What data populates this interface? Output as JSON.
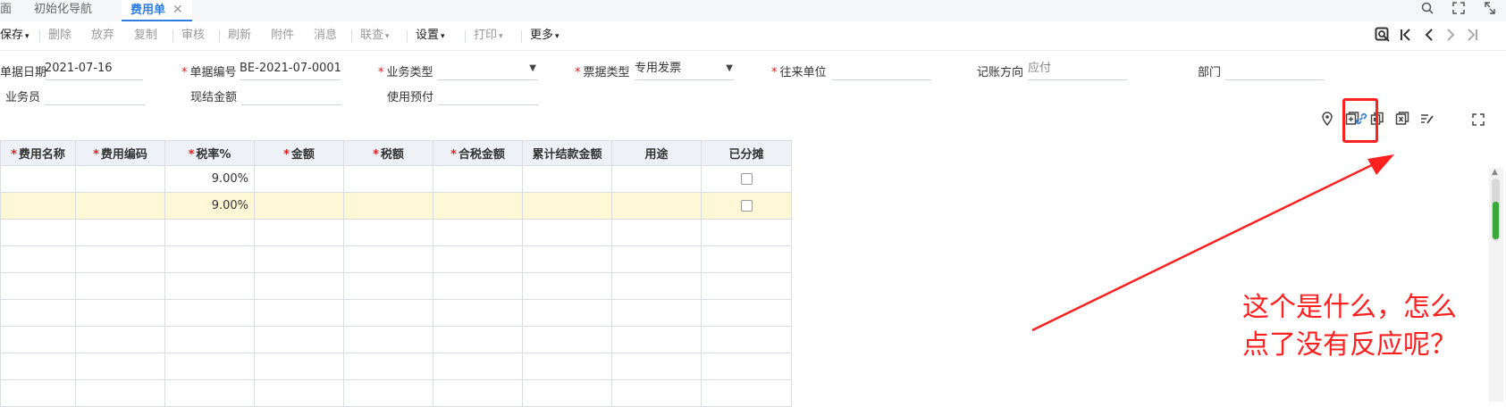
{
  "tabs": [
    {
      "label": "面",
      "active": false
    },
    {
      "label": "初始化导航",
      "active": false
    },
    {
      "label": "费用单",
      "active": true
    }
  ],
  "tab_close_glyph": "✕",
  "window_icons": [
    "search-icon",
    "expand-icon",
    "restore-icon"
  ],
  "toolbar": {
    "save": "保存",
    "delete": "删除",
    "discard": "放弃",
    "copy": "复制",
    "audit": "审核",
    "refresh": "刷新",
    "attachment": "附件",
    "message": "消息",
    "linked_query": "联查",
    "settings": "设置",
    "print": "打印",
    "more": "更多"
  },
  "nav_icons": [
    "search-doc-icon",
    "first-page-icon",
    "prev-page-icon",
    "next-page-icon",
    "last-page-icon"
  ],
  "form": {
    "doc_date_label": "单据日期",
    "doc_date_value": "2021-07-16",
    "doc_no_label": "单据编号",
    "doc_no_value": "BE-2021-07-0001",
    "biz_type_label": "业务类型",
    "biz_type_value": "",
    "invoice_type_label": "票据类型",
    "invoice_type_value": "专用发票",
    "partner_label": "往来单位",
    "partner_value": "",
    "direction_label": "记账方向",
    "direction_value": "应付",
    "dept_label": "部门",
    "dept_value": "",
    "clerk_label": "业务员",
    "clerk_value": "",
    "cash_amount_label": "现结金额",
    "cash_amount_value": "",
    "prepaid_label": "使用预付",
    "prepaid_value": ""
  },
  "action_icons": [
    "location-icon",
    "add-row-icon",
    "copy-row-icon",
    "delete-row-icon",
    "edit-icon",
    "link-icon",
    "fullscreen-icon"
  ],
  "table": {
    "columns": [
      {
        "label": "费用名称",
        "required": true
      },
      {
        "label": "费用编码",
        "required": true
      },
      {
        "label": "税率%",
        "required": true
      },
      {
        "label": "金额",
        "required": true
      },
      {
        "label": "税额",
        "required": true
      },
      {
        "label": "合税金额",
        "required": true
      },
      {
        "label": "累计结款金额",
        "required": false
      },
      {
        "label": "用途",
        "required": false
      },
      {
        "label": "已分摊",
        "required": false
      }
    ],
    "rows": [
      {
        "tax_rate": "9.00%",
        "checkbox": true,
        "selected": false
      },
      {
        "tax_rate": "9.00%",
        "checkbox": true,
        "selected": true
      },
      {
        "tax_rate": "",
        "checkbox": false,
        "selected": false
      },
      {
        "tax_rate": "",
        "checkbox": false,
        "selected": false
      },
      {
        "tax_rate": "",
        "checkbox": false,
        "selected": false
      },
      {
        "tax_rate": "",
        "checkbox": false,
        "selected": false
      },
      {
        "tax_rate": "",
        "checkbox": false,
        "selected": false
      },
      {
        "tax_rate": "",
        "checkbox": false,
        "selected": false
      },
      {
        "tax_rate": "",
        "checkbox": false,
        "selected": false
      }
    ]
  },
  "annotation": {
    "line1": "这个是什么，怎么",
    "line2": "点了没有反应呢？",
    "color": "#ff2020"
  },
  "colors": {
    "accent": "#2e7de1",
    "required": "#e02020",
    "selected_row": "#fff7d6"
  }
}
